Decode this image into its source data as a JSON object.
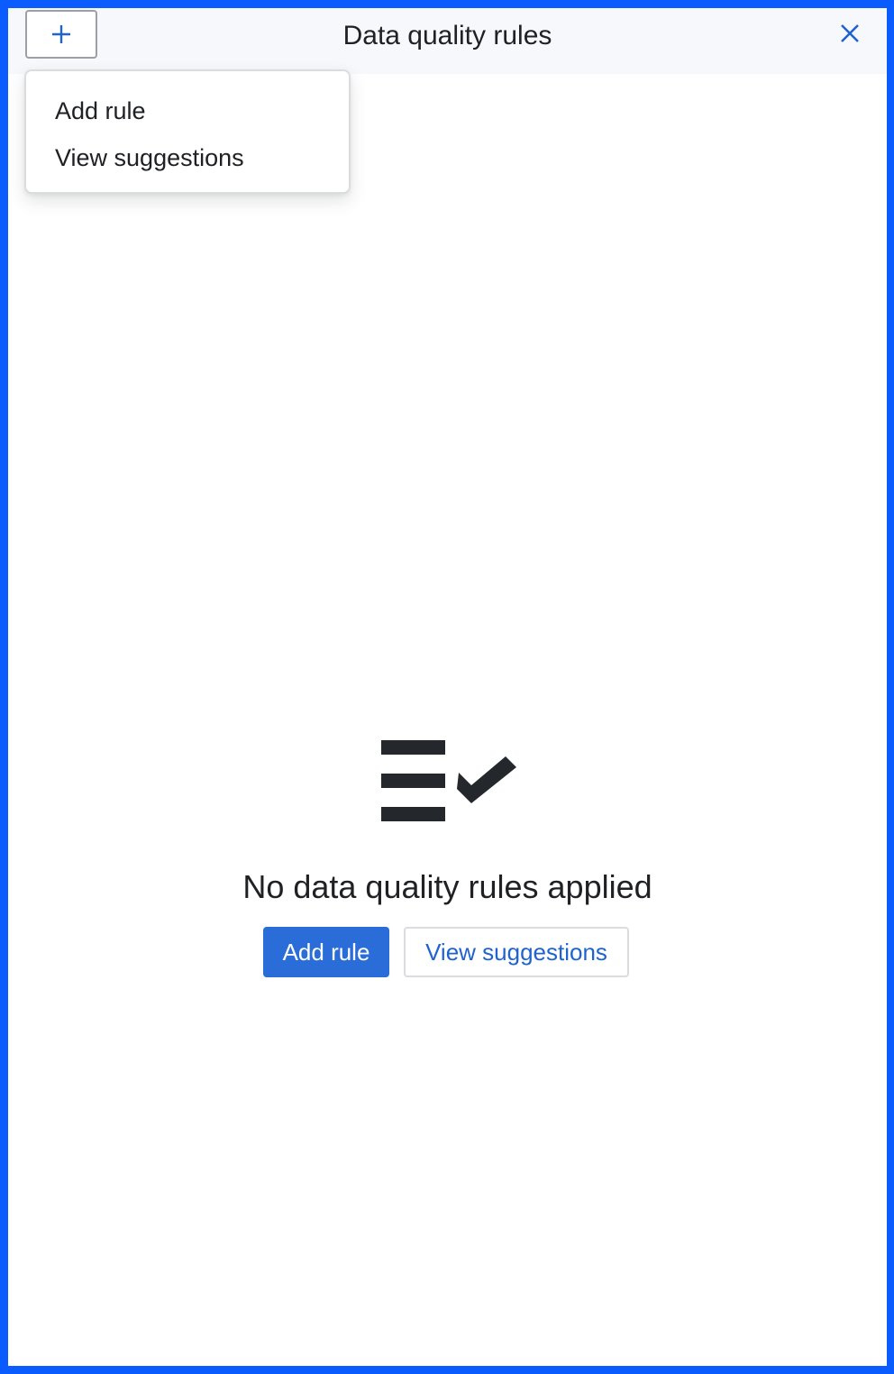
{
  "header": {
    "title": "Data quality rules",
    "add_icon": "plus-icon",
    "close_icon": "close-icon"
  },
  "dropdown": {
    "items": [
      {
        "label": "Add rule"
      },
      {
        "label": "View suggestions"
      }
    ]
  },
  "empty_state": {
    "icon": "checklist-icon",
    "message": "No data quality rules applied",
    "primary_label": "Add rule",
    "secondary_label": "View suggestions"
  },
  "colors": {
    "accent": "#2a6dd9",
    "frame": "#0a5cff",
    "header_bg": "#f6f8fb",
    "text": "#202124"
  }
}
